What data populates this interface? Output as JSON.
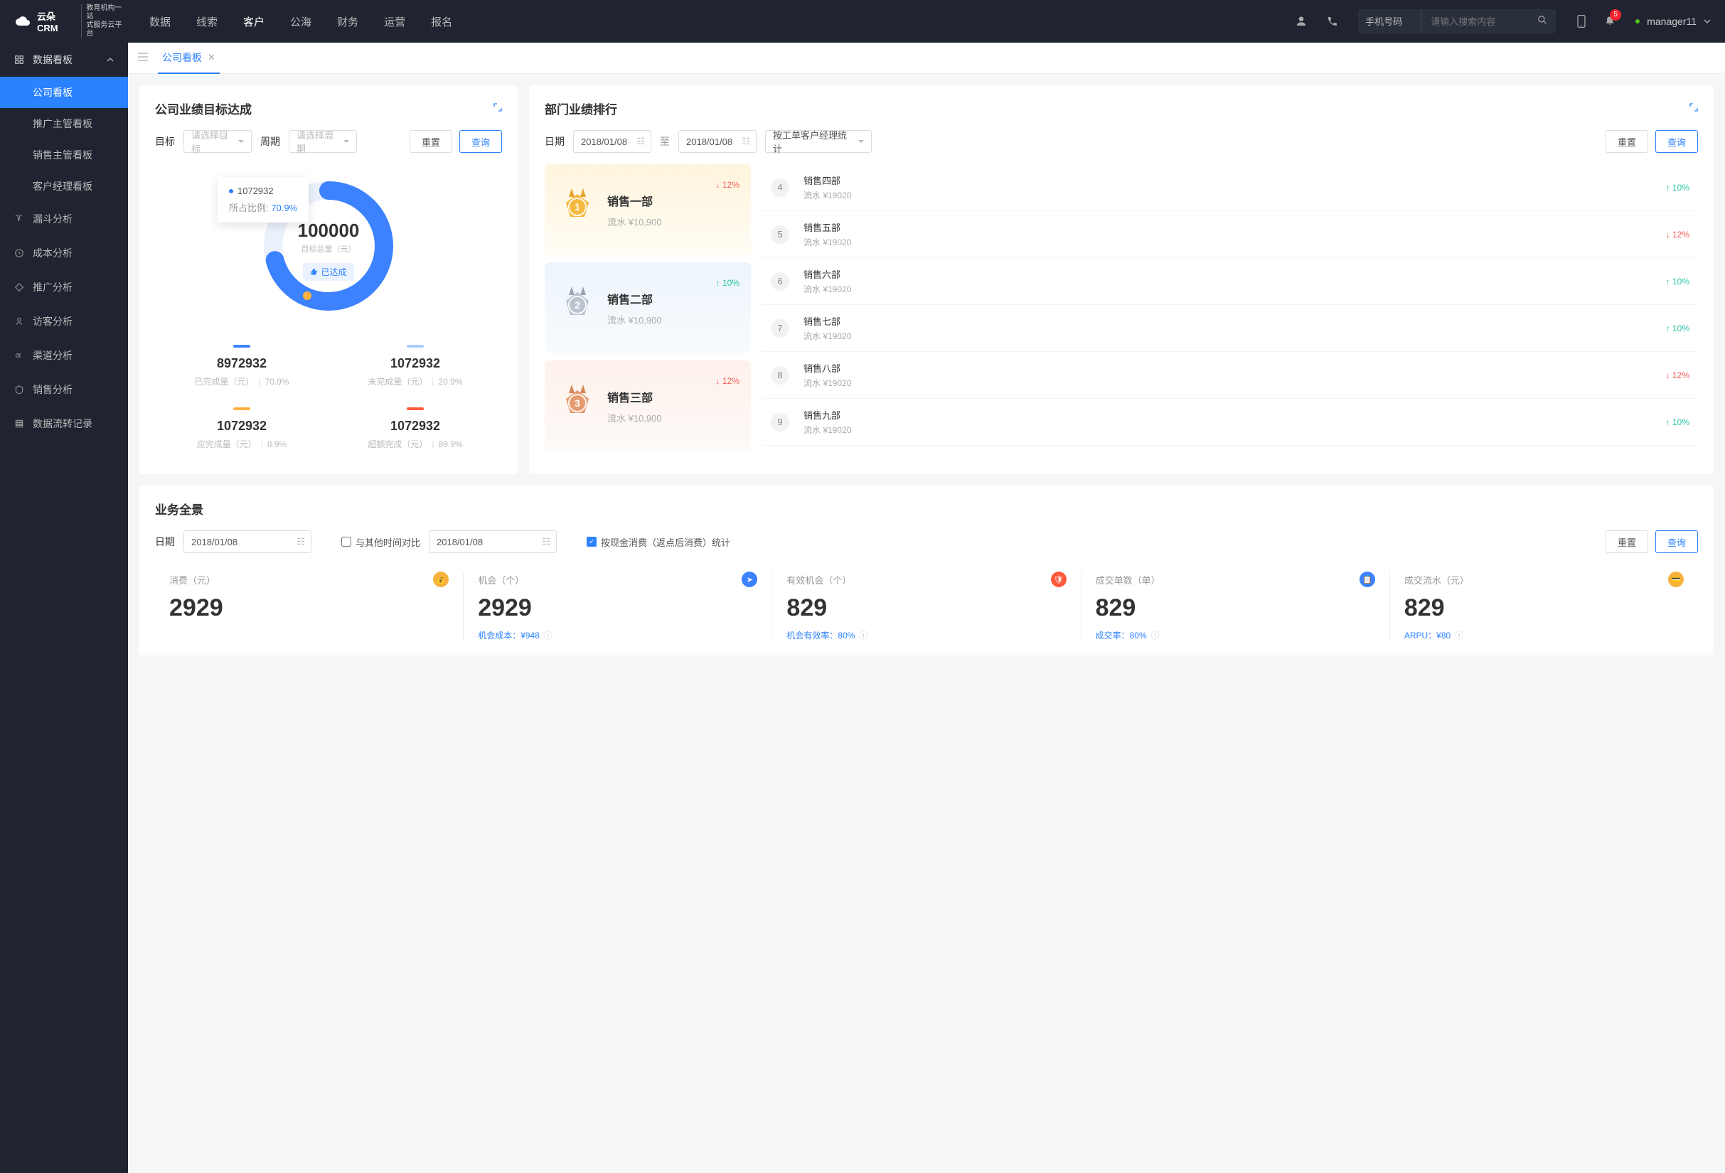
{
  "brand": {
    "main": "云朵CRM",
    "sub1": "教育机构一站",
    "sub2": "式服务云平台"
  },
  "topnav": {
    "items": [
      "数据",
      "线索",
      "客户",
      "公海",
      "财务",
      "运营",
      "报名"
    ],
    "active": 2
  },
  "search": {
    "type": "手机号码",
    "placeholder": "请输入搜索内容"
  },
  "notif_count": "5",
  "user": "manager11",
  "sidebar": {
    "group": "数据看板",
    "subs": [
      "公司看板",
      "推广主管看板",
      "销售主管看板",
      "客户经理看板"
    ],
    "active_sub": 0,
    "items": [
      "漏斗分析",
      "成本分析",
      "推广分析",
      "访客分析",
      "渠道分析",
      "销售分析",
      "数据流转记录"
    ]
  },
  "tab": {
    "label": "公司看板"
  },
  "goal": {
    "title": "公司业绩目标达成",
    "target_lbl": "目标",
    "target_ph": "请选择目标",
    "period_lbl": "周期",
    "period_ph": "请选择周期",
    "reset": "重置",
    "query": "查询",
    "tooltip_val": "1072932",
    "tooltip_rate_lbl": "所占比例:",
    "tooltip_rate": "70.9%",
    "center_val": "100000",
    "center_lbl": "目标总量（元）",
    "tag": "已达成",
    "s1": {
      "color": "#3c82ff",
      "v": "8972932",
      "lbl": "已完成量（元）",
      "pct": "70.9%"
    },
    "s2": {
      "color": "#a9cdff",
      "v": "1072932",
      "lbl": "未完成量（元）",
      "pct": "20.9%"
    },
    "s3": {
      "color": "#ffb23e",
      "v": "1072932",
      "lbl": "应完成量（元）",
      "pct": "8.9%"
    },
    "s4": {
      "color": "#ff5a3c",
      "v": "1072932",
      "lbl": "超额完成（元）",
      "pct": "89.9%"
    }
  },
  "rank": {
    "title": "部门业绩排行",
    "date_lbl": "日期",
    "d1": "2018/01/08",
    "to": "至",
    "d2": "2018/01/08",
    "by": "按工单客户经理统计",
    "reset": "重置",
    "query": "查询",
    "podium": [
      {
        "n": "1",
        "name": "销售一部",
        "flow": "流水 ¥10,900",
        "dir": "down",
        "pct": "12%"
      },
      {
        "n": "2",
        "name": "销售二部",
        "flow": "流水 ¥10,900",
        "dir": "up",
        "pct": "10%"
      },
      {
        "n": "3",
        "name": "销售三部",
        "flow": "流水 ¥10,900",
        "dir": "down",
        "pct": "12%"
      }
    ],
    "list": [
      {
        "n": "4",
        "name": "销售四部",
        "flow": "流水 ¥19020",
        "dir": "up",
        "pct": "10%"
      },
      {
        "n": "5",
        "name": "销售五部",
        "flow": "流水 ¥19020",
        "dir": "down",
        "pct": "12%"
      },
      {
        "n": "6",
        "name": "销售六部",
        "flow": "流水 ¥19020",
        "dir": "up",
        "pct": "10%"
      },
      {
        "n": "7",
        "name": "销售七部",
        "flow": "流水 ¥19020",
        "dir": "up",
        "pct": "10%"
      },
      {
        "n": "8",
        "name": "销售八部",
        "flow": "流水 ¥19020",
        "dir": "down",
        "pct": "12%"
      },
      {
        "n": "9",
        "name": "销售九部",
        "flow": "流水 ¥19020",
        "dir": "up",
        "pct": "10%"
      }
    ]
  },
  "over": {
    "title": "业务全景",
    "date_lbl": "日期",
    "d1": "2018/01/08",
    "compare": "与其他时间对比",
    "d2": "2018/01/08",
    "cash_stat": "按现金消费（返点后消费）统计",
    "reset": "重置",
    "query": "查询",
    "kpis": [
      {
        "lbl": "消费（元）",
        "v": "2929",
        "sub": "",
        "ico": "#f6b23d"
      },
      {
        "lbl": "机会（个）",
        "v": "2929",
        "sub": "机会成本：¥948",
        "ico": "#3c82ff"
      },
      {
        "lbl": "有效机会（个）",
        "v": "829",
        "sub": "机会有效率：80%",
        "ico": "#ff5a3c"
      },
      {
        "lbl": "成交单数（单）",
        "v": "829",
        "sub": "成交率：80%",
        "ico": "#3c82ff"
      },
      {
        "lbl": "成交流水（元）",
        "v": "829",
        "sub": "ARPU：¥80",
        "ico": "#f6b23d"
      }
    ]
  },
  "chart_data": {
    "type": "pie",
    "title": "公司业绩目标达成",
    "total": 100000,
    "slices": [
      {
        "name": "已完成量（元）",
        "value": 8972932,
        "pct": 70.9,
        "color": "#3c82ff"
      },
      {
        "name": "未完成量（元）",
        "value": 1072932,
        "pct": 20.9,
        "color": "#a9cdff"
      },
      {
        "name": "应完成量（元）",
        "value": 1072932,
        "pct": 8.9,
        "color": "#ffb23e"
      },
      {
        "name": "超额完成（元）",
        "value": 1072932,
        "pct": 89.9,
        "color": "#ff5a3c"
      }
    ],
    "highlight": {
      "value": 1072932,
      "pct": 70.9
    }
  }
}
